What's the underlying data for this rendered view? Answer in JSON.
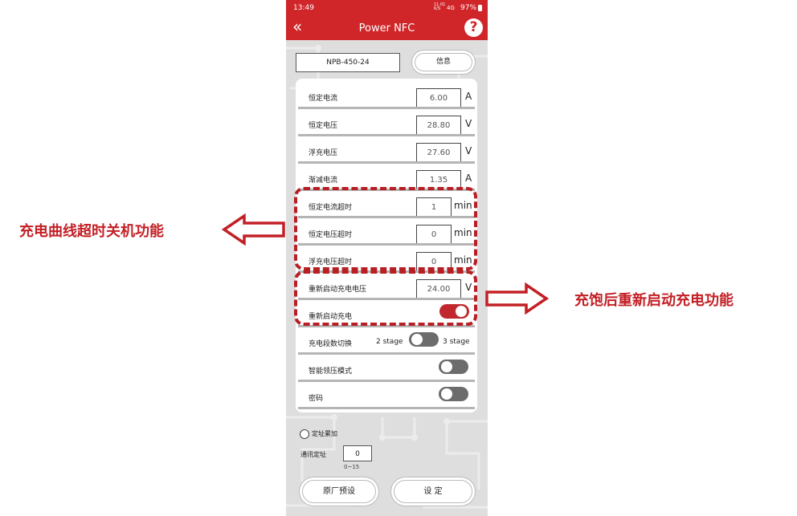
{
  "status_bar": {
    "time": "13:49",
    "network_top": "11.01",
    "network_bottom": "K/S",
    "signal": "4G",
    "battery": "97%"
  },
  "app": {
    "title": "Power NFC",
    "back_glyph": "«",
    "help_glyph": "?"
  },
  "device": {
    "model": "NPB-450-24",
    "info_label": "信息"
  },
  "settings": {
    "cc_label": "恒定电流",
    "cc_value": "6.00",
    "cc_unit": "A",
    "cv_label": "恒定电压",
    "cv_value": "28.80",
    "cv_unit": "V",
    "float_label": "浮充电压",
    "float_value": "27.60",
    "float_unit": "V",
    "taper_label": "渐减电流",
    "taper_value": "1.35",
    "taper_unit": "A",
    "cc_timeout_label": "恒定电流超时",
    "cc_timeout_value": "1",
    "cc_timeout_unit": "min",
    "cv_timeout_label": "恒定电压超时",
    "cv_timeout_value": "0",
    "cv_timeout_unit": "min",
    "float_timeout_label": "浮充电压超时",
    "float_timeout_value": "0",
    "float_timeout_unit": "min",
    "restart_voltage_label": "重新启动充电电压",
    "restart_voltage_value": "24.00",
    "restart_voltage_unit": "V",
    "restart_charge_label": "重新启动充电",
    "restart_charge_on": true,
    "stage_label": "充电段数切换",
    "stage_left": "2 stage",
    "stage_right": "3 stage",
    "smart_label": "智能领压模式",
    "smart_on": false,
    "password_label": "密码",
    "password_on": false
  },
  "address": {
    "accumulate_label": "定址累加",
    "comm_label": "通讯定址",
    "value": "0",
    "range": "0~15"
  },
  "buttons": {
    "factory_reset": "原厂预设",
    "apply": "设 定"
  },
  "annotations": {
    "left_text": "充电曲线超时关机功能",
    "right_text": "充饱后重新启动充电功能",
    "color": "#c32026"
  }
}
